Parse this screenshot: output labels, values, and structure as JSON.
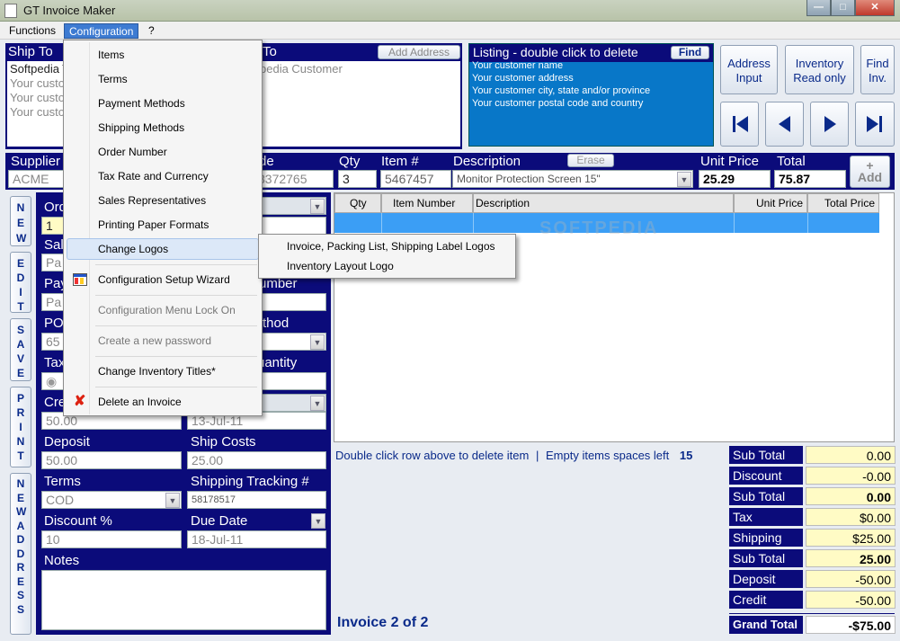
{
  "window": {
    "title": "GT Invoice Maker"
  },
  "menubar": {
    "functions": "Functions",
    "configuration": "Configuration",
    "help": "?"
  },
  "config_menu": {
    "items": "Items",
    "terms": "Terms",
    "payment_methods": "Payment Methods",
    "shipping_methods": "Shipping Methods",
    "order_number": "Order Number",
    "tax_rate": "Tax Rate and Currency",
    "sales_reps": "Sales Representatives",
    "printing_paper": "Printing Paper Formats",
    "change_logos": "Change Logos",
    "setup_wizard": "Configuration Setup Wizard",
    "menu_lock": "Configuration Menu Lock On",
    "new_password": "Create a new password",
    "change_titles": "Change Inventory Titles*",
    "delete_invoice": "Delete an Invoice"
  },
  "logos_submenu": {
    "invoice_logos": "Invoice, Packing List, Shipping Label Logos",
    "inventory_logo": "Inventory Layout Logo"
  },
  "ship_to": {
    "header": "Ship To",
    "line1": "Softpedia T",
    "line2": "Your custo",
    "line3": "Your custo",
    "line4": "Your custo"
  },
  "bill_to": {
    "header": "To",
    "add_address": "Add Address",
    "line1": "pedia Customer"
  },
  "listing": {
    "header": "Listing - double click to delete",
    "find": "Find",
    "lines": [
      "Your customer name",
      "Your customer address",
      "Your customer city, state and/or province",
      "Your customer postal code and country"
    ]
  },
  "top_buttons": {
    "address_input": "Address Input",
    "inventory_read": "Inventory Read only",
    "find_inv": "Find Inv."
  },
  "item_bar": {
    "supplier_label": "Supplier",
    "supplier_value": "ACME",
    "code_label": "de",
    "code_value": "3372765",
    "qty_label": "Qty",
    "qty_value": "3",
    "item_label": "Item #",
    "item_value": "5467457",
    "desc_label": "Description",
    "erase": "Erase",
    "desc_value": "Monitor Protection Screen 15\"",
    "unit_label": "Unit Price",
    "unit_value": "25.29",
    "total_label": "Total",
    "total_value": "75.87",
    "add": "Add"
  },
  "side_buttons": {
    "new": "NEW",
    "edit": "EDIT",
    "save": "SAVE",
    "print": "PRINT",
    "new_address": "NEW ADDRESS"
  },
  "form": {
    "order": {
      "label": "Ord",
      "value": "1"
    },
    "sales": {
      "label": "Sal",
      "value": "Pa"
    },
    "pay": {
      "label": "Pay",
      "value": "Pa"
    },
    "po": {
      "label": "PO",
      "value": "65"
    },
    "tax": {
      "label": "Tax"
    },
    "credit": {
      "label": "Cre",
      "value": "50.00"
    },
    "date": {
      "value": "13-Jul-11"
    },
    "number_label": "umber",
    "method_label": "thod",
    "quantity_label": "uantity",
    "deposit": {
      "label": "Deposit",
      "value": "50.00"
    },
    "ship_costs": {
      "label": "Ship Costs",
      "value": "25.00"
    },
    "terms": {
      "label": "Terms",
      "value": "COD"
    },
    "tracking": {
      "label": "Shipping Tracking  #",
      "value": "58178517"
    },
    "discount": {
      "label": "Discount %",
      "value": "10"
    },
    "due_date": {
      "label": "Due Date",
      "value": "18-Jul-11"
    },
    "notes": {
      "label": "Notes"
    }
  },
  "items_table": {
    "headers": [
      "Qty",
      "Item Number",
      "Description",
      "Unit Price",
      "Total Price"
    ]
  },
  "status": {
    "hint": "Double click row above to delete item",
    "sep": "|",
    "empty_label": "Empty items spaces left",
    "empty_count": "15"
  },
  "invoice_counter": "Invoice 2 of 2",
  "totals": [
    {
      "label": "Sub Total",
      "value": "0.00"
    },
    {
      "label": "Discount",
      "value": "-0.00"
    },
    {
      "label": "Sub Total",
      "value": "0.00"
    },
    {
      "label": "Tax",
      "value": "$0.00"
    },
    {
      "label": "Shipping",
      "value": "$25.00"
    },
    {
      "label": "Sub Total",
      "value": "25.00"
    },
    {
      "label": "Deposit",
      "value": "-50.00"
    },
    {
      "label": "Credit",
      "value": "-50.00"
    }
  ],
  "grand_total": {
    "label": "Grand Total",
    "value": "-$75.00"
  },
  "watermark": "SOFTPEDIA",
  "colors": {
    "navy": "#0b0b7a",
    "listing_blue": "#0877c8",
    "menu_active": "#3d7bd2",
    "total_yellow": "#fffbc5"
  }
}
